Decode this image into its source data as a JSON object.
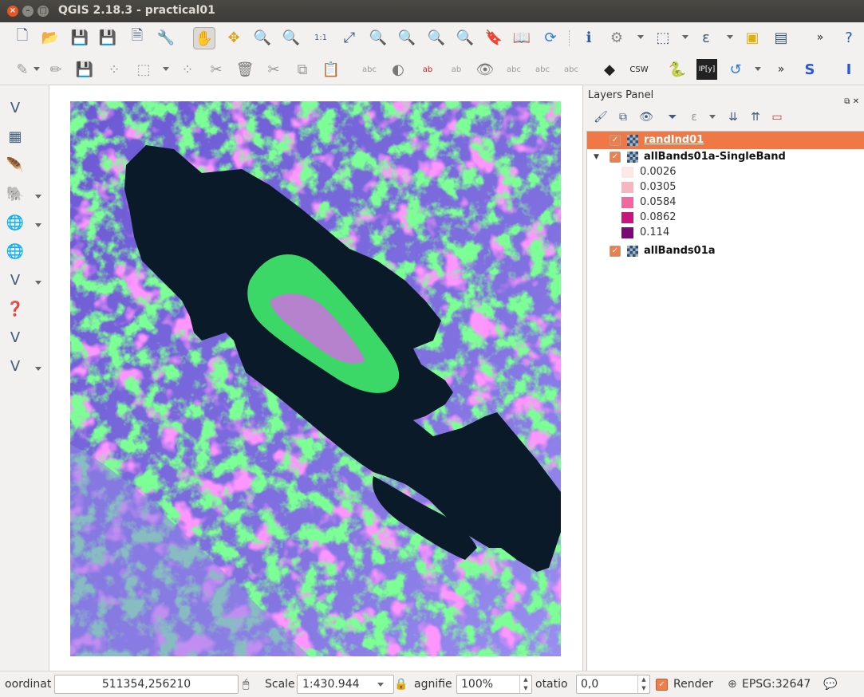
{
  "window": {
    "title": "QGIS 2.18.3 - practical01"
  },
  "layers_panel": {
    "title": "Layers Panel",
    "layers": [
      {
        "name": "randInd01",
        "selected": true
      },
      {
        "name": "allBands01a-SingleBand",
        "expanded": true,
        "legend": [
          {
            "value": "0.0026",
            "color": "#fde8e6"
          },
          {
            "value": "0.0305",
            "color": "#f6b6c0"
          },
          {
            "value": "0.0584",
            "color": "#f2679e"
          },
          {
            "value": "0.0862",
            "color": "#c9137d"
          },
          {
            "value": "0.114",
            "color": "#7a0777"
          }
        ]
      },
      {
        "name": "allBands01a"
      }
    ]
  },
  "status": {
    "coord_label": "oordinat",
    "coord_value": "511354,256210",
    "scale_label": "Scale",
    "scale_value": "1:430.944",
    "magnifier_label": "agnifie",
    "magnifier_value": "100%",
    "rotation_label": "otatio",
    "rotation_value": "0,0",
    "render_label": "Render",
    "crs": "EPSG:32647"
  },
  "colors": {
    "accent": "#f07746",
    "selected_row": "#f07746"
  }
}
